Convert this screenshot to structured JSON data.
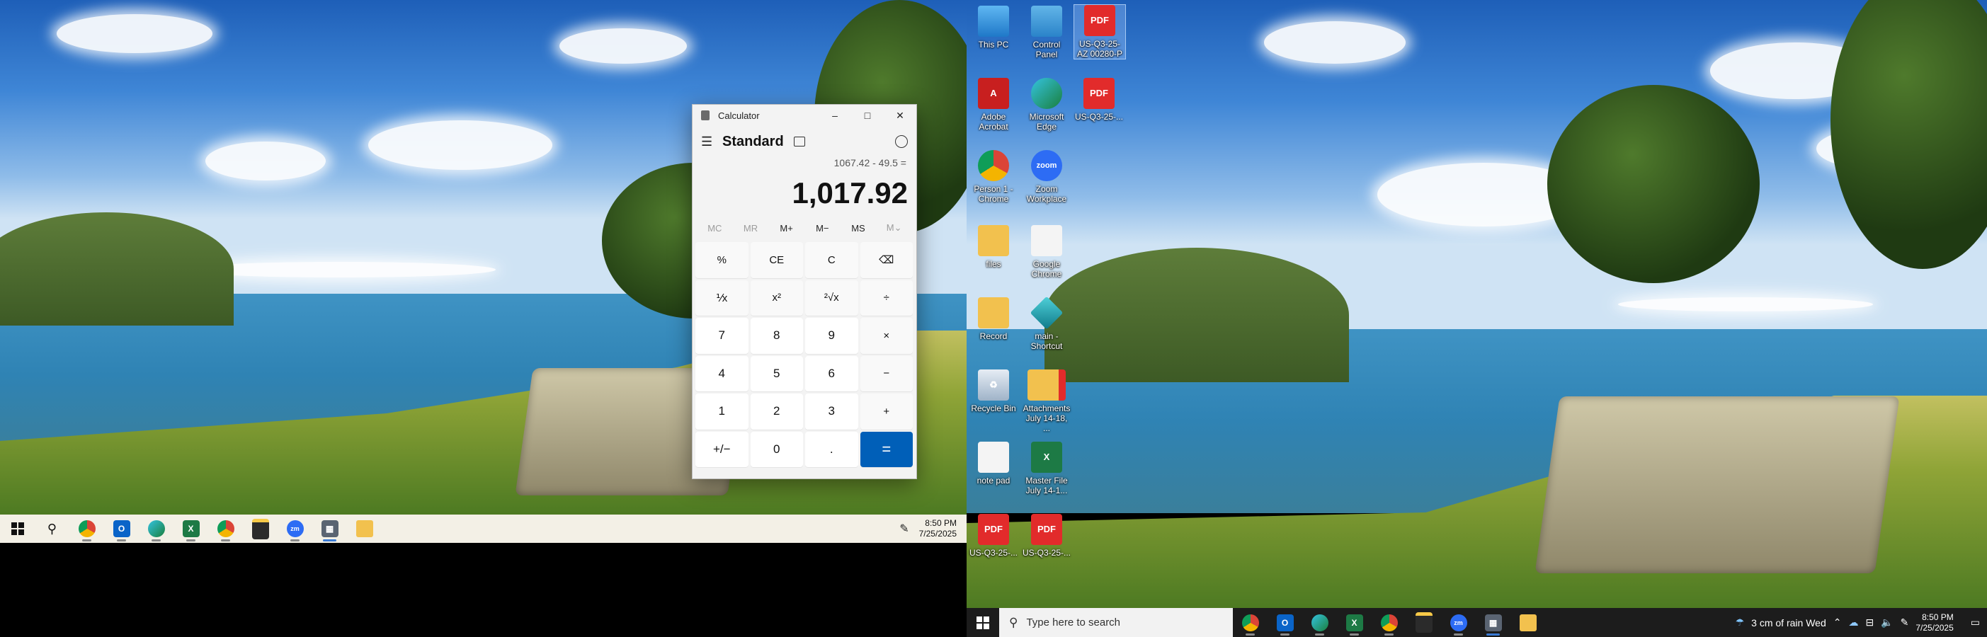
{
  "left_screen": {
    "calculator": {
      "window_title": "Calculator",
      "controls": [
        "–",
        "□",
        "✕"
      ],
      "mode_title": "Standard",
      "expression": "1067.42 - 49.5 =",
      "display_value": "1,017.92",
      "memory_buttons": [
        "MC",
        "MR",
        "M+",
        "M−",
        "MS",
        "M⌄"
      ],
      "keys": [
        "%",
        "CE",
        "C",
        "⌫",
        "⅟x",
        "x²",
        "²√x",
        "÷",
        "7",
        "8",
        "9",
        "×",
        "4",
        "5",
        "6",
        "−",
        "1",
        "2",
        "3",
        "+",
        "+/−",
        "0",
        ".",
        "="
      ]
    },
    "taskbar": {
      "apps": [
        "search-icon",
        "chrome-icon",
        "outlook-icon",
        "edge-icon",
        "excel-icon",
        "chrome-profile-icon",
        "sticky-notes-icon",
        "zoom-icon",
        "calculator-icon",
        "file-explorer-icon"
      ],
      "time": "8:50 PM",
      "date": "7/25/2025"
    }
  },
  "right_screen": {
    "desktop_icons": [
      {
        "label": "This PC",
        "icon": "pc-icon"
      },
      {
        "label": "Control Panel",
        "icon": "control-panel-icon"
      },
      {
        "label": "US-Q3-25-AZ 00280-P",
        "icon": "pdf-icon"
      },
      {
        "label": "Adobe Acrobat",
        "icon": "acrobat-icon"
      },
      {
        "label": "Microsoft Edge",
        "icon": "edge-icon"
      },
      {
        "label": "US-Q3-25-...",
        "icon": "pdf-icon"
      },
      {
        "label": "Person 1 - Chrome",
        "icon": "chrome-icon"
      },
      {
        "label": "Zoom Workplace",
        "icon": "zoom-icon"
      },
      {
        "label": "files",
        "icon": "folder-icon"
      },
      {
        "label": "Google Chrome",
        "icon": "file-icon"
      },
      {
        "label": "Record",
        "icon": "folder-icon"
      },
      {
        "label": "main - Shortcut",
        "icon": "shortcut-icon"
      },
      {
        "label": "Recycle Bin",
        "icon": "recycle-bin-icon"
      },
      {
        "label": "Attachments July 14-18, ...",
        "icon": "folder-pdf-icon"
      },
      {
        "label": "note pad",
        "icon": "text-file-icon"
      },
      {
        "label": "Master File July 14-1...",
        "icon": "excel-file-icon"
      },
      {
        "label": "US-Q3-25-...",
        "icon": "pdf-icon"
      },
      {
        "label": "US-Q3-25-...",
        "icon": "pdf-icon"
      }
    ],
    "icon_badges": {
      "pdf": "PDF",
      "zoom": "zoom",
      "excel": "X"
    },
    "taskbar": {
      "search_placeholder": "Type here to search",
      "weather": "3 cm of rain Wed",
      "time": "8:50 PM",
      "date": "7/25/2025"
    }
  },
  "colors": {
    "equals_key": "#005fb8",
    "taskbar_dark": "#1c1c1c",
    "taskbar_light": "#f3f0e6"
  }
}
